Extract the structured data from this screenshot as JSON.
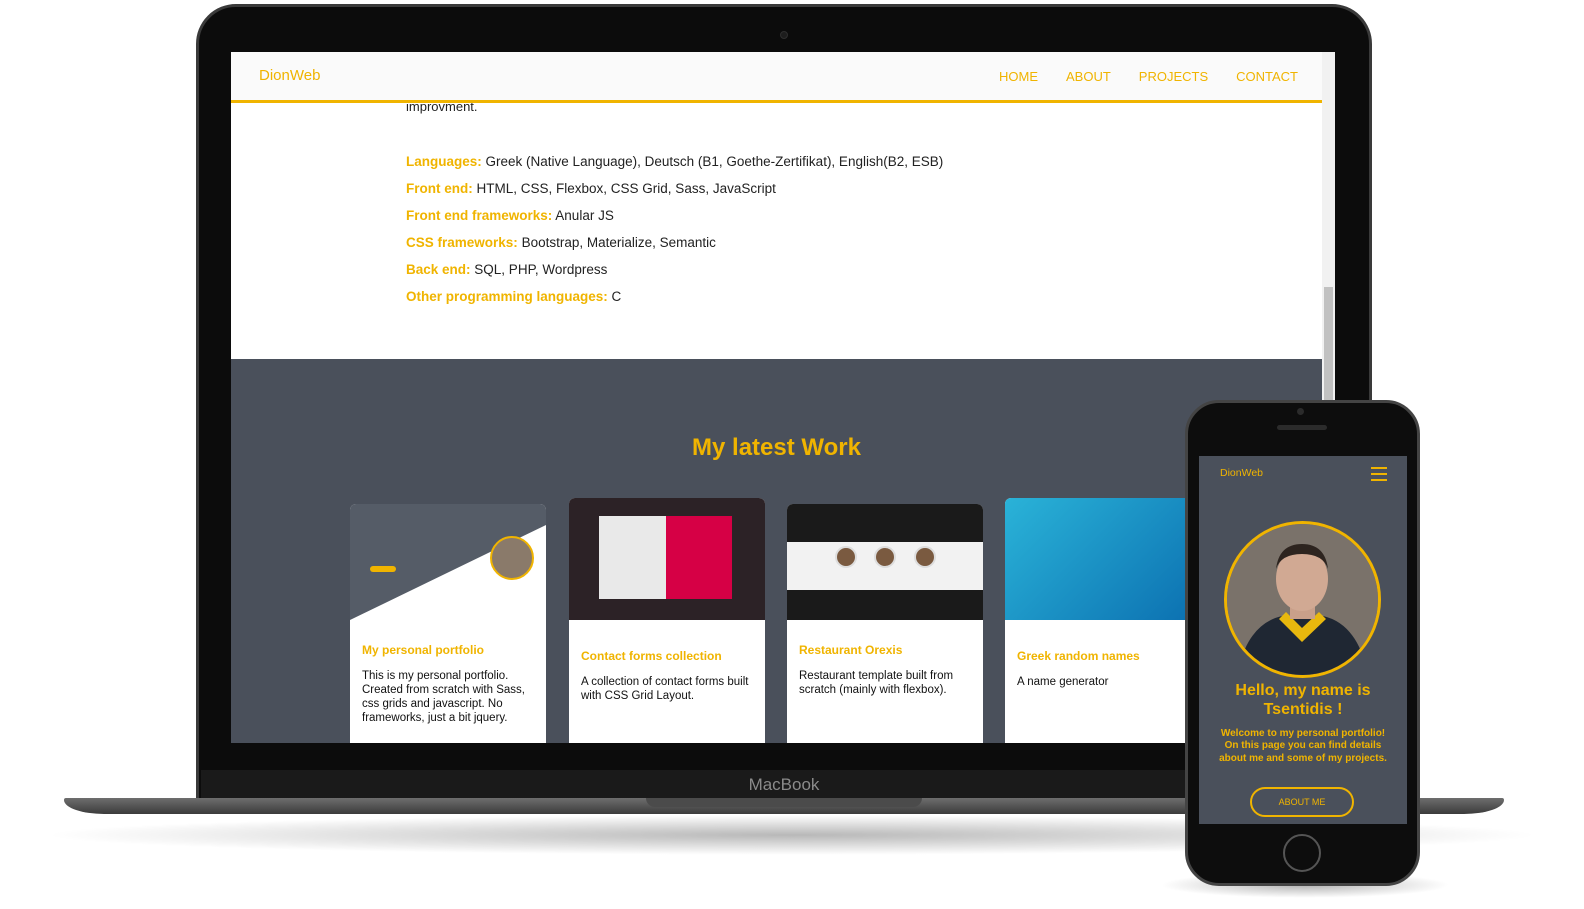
{
  "site": {
    "logo": "DionWeb",
    "nav": [
      "HOME",
      "ABOUT",
      "PROJECTS",
      "CONTACT"
    ]
  },
  "about": {
    "cut_text": "improvment.",
    "skills": [
      {
        "label": "Languages:",
        "value": "Greek (Native Language), Deutsch (B1, Goethe-Zertifikat), English(B2, ESB)"
      },
      {
        "label": "Front end:",
        "value": "HTML, CSS, Flexbox, CSS Grid, Sass, JavaScript"
      },
      {
        "label": "Front end frameworks:",
        "value": "Anular JS"
      },
      {
        "label": "CSS frameworks:",
        "value": "Bootstrap, Materialize, Semantic"
      },
      {
        "label": "Back end:",
        "value": "SQL, PHP, Wordpress"
      },
      {
        "label": "Other programming languages:",
        "value": "C"
      }
    ]
  },
  "work": {
    "title": "My latest Work",
    "projects": [
      {
        "title": "My personal portfolio",
        "desc": "This is my personal portfolio. Created from scratch with Sass, css grids and javascript. No frameworks, just a bit jquery."
      },
      {
        "title": "Contact forms collection",
        "desc": "A collection of contact forms built with CSS Grid Layout."
      },
      {
        "title": "Restaurant Orexis",
        "desc": "Restaurant template built from scratch (mainly with flexbox)."
      },
      {
        "title": "Greek random names",
        "desc": "A name generator"
      }
    ]
  },
  "device": {
    "laptop_brand": "MacBook"
  },
  "mobile": {
    "logo": "DionWeb",
    "heading": "Hello, my name is Tsentidis !",
    "intro": "Welcome to my personal portfolio! On this page you can find details about me and some of my projects.",
    "button": "ABOUT ME"
  },
  "colors": {
    "accent": "#f0b400",
    "section_bg": "#4a505b"
  }
}
